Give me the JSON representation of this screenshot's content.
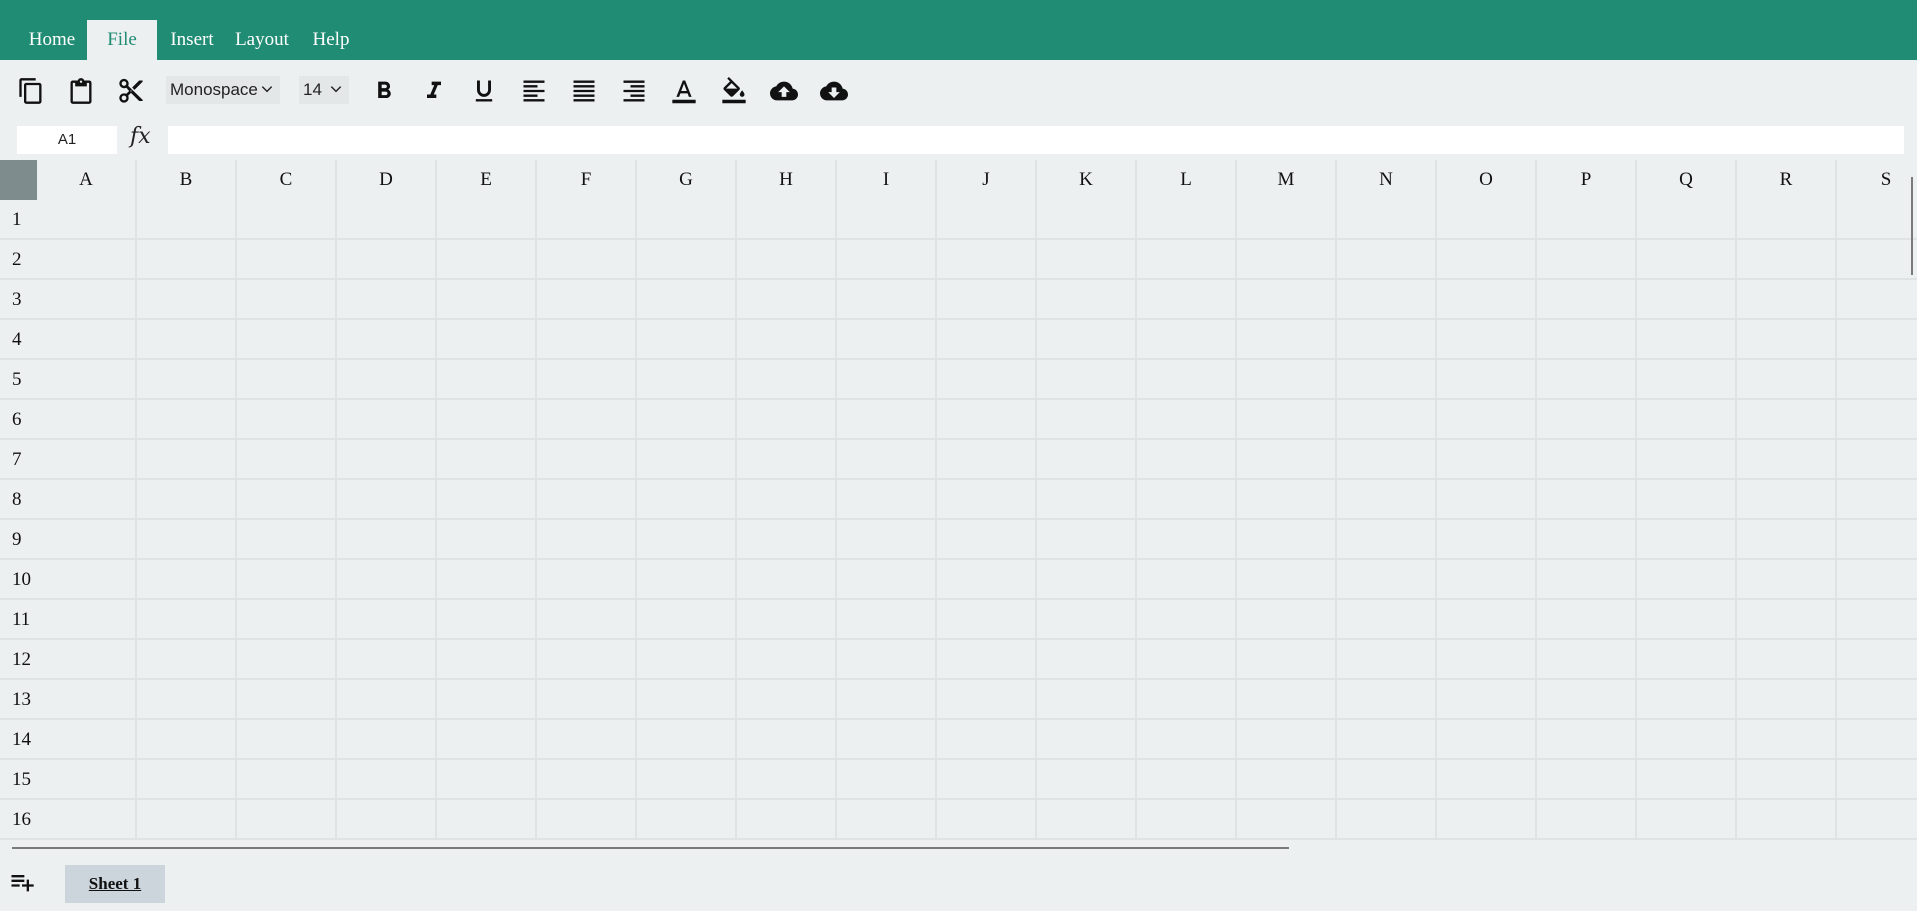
{
  "menu": {
    "items": [
      {
        "label": "Home",
        "active": false
      },
      {
        "label": "File",
        "active": true
      },
      {
        "label": "Insert",
        "active": false
      },
      {
        "label": "Layout",
        "active": false
      },
      {
        "label": "Help",
        "active": false
      }
    ]
  },
  "toolbar": {
    "font_family": "Monospace",
    "font_size": "14",
    "icons": [
      "copy-icon",
      "paste-icon",
      "cut-icon",
      "bold-icon",
      "italic-icon",
      "underline-icon",
      "align-left-icon",
      "align-justify-icon",
      "align-right-icon",
      "text-color-icon",
      "fill-color-icon",
      "upload-icon",
      "download-icon"
    ]
  },
  "formula_bar": {
    "cell_ref": "A1",
    "fx_label": "fx",
    "value": ""
  },
  "grid": {
    "columns": [
      "A",
      "B",
      "C",
      "D",
      "E",
      "F",
      "G",
      "H",
      "I",
      "J",
      "K",
      "L",
      "M",
      "N",
      "O",
      "P",
      "Q",
      "R",
      "S"
    ],
    "rows": [
      "1",
      "2",
      "3",
      "4",
      "5",
      "6",
      "7",
      "8",
      "9",
      "10",
      "11",
      "12",
      "13",
      "14",
      "15",
      "16"
    ]
  },
  "sheets": {
    "tabs": [
      {
        "label": "Sheet 1",
        "active": true
      }
    ]
  },
  "colors": {
    "menubar": "#218c74",
    "background": "#ecf0f1",
    "corner": "#7f8c8d"
  }
}
